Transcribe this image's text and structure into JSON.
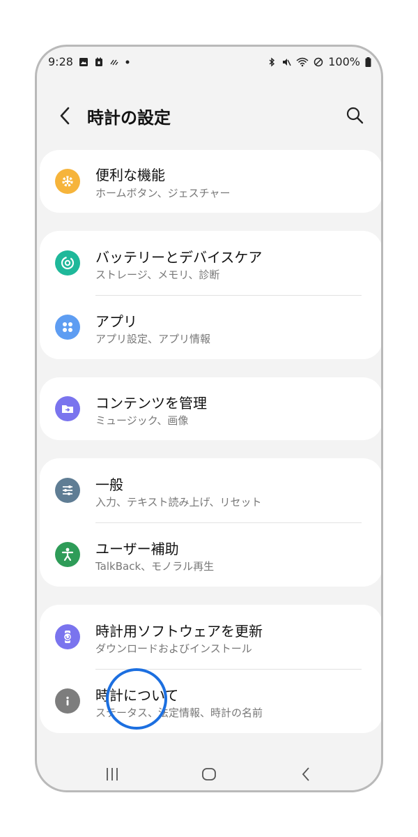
{
  "status_bar": {
    "time": "9:28",
    "battery": "100%",
    "left_icons": [
      "gallery-icon",
      "calendar-icon",
      "wearable-icon",
      "dot-icon"
    ],
    "right_icons": [
      "bluetooth-icon",
      "mute-icon",
      "wifi-icon",
      "dnd-icon",
      "battery-icon"
    ]
  },
  "header": {
    "title": "時計の設定"
  },
  "sections": [
    {
      "items": [
        {
          "title": "便利な機能",
          "subtitle": "ホームボタン、ジェスチャー",
          "icon": "gear-icon",
          "color": "#f6b43b"
        }
      ]
    },
    {
      "items": [
        {
          "title": "バッテリーとデバイスケア",
          "subtitle": "ストレージ、メモリ、診断",
          "icon": "device-care-icon",
          "color": "#1fb89a"
        },
        {
          "title": "アプリ",
          "subtitle": "アプリ設定、アプリ情報",
          "icon": "apps-icon",
          "color": "#5e9df2"
        }
      ]
    },
    {
      "items": [
        {
          "title": "コンテンツを管理",
          "subtitle": "ミュージック、画像",
          "icon": "folder-icon",
          "color": "#7a74ee"
        }
      ]
    },
    {
      "items": [
        {
          "title": "一般",
          "subtitle": "入力、テキスト読み上げ、リセット",
          "icon": "sliders-icon",
          "color": "#5f7d94"
        },
        {
          "title": "ユーザー補助",
          "subtitle": "TalkBack、モノラル再生",
          "icon": "accessibility-icon",
          "color": "#2e9c58"
        }
      ]
    },
    {
      "items": [
        {
          "title": "時計用ソフトウェアを更新",
          "subtitle": "ダウンロードおよびインストール",
          "icon": "watch-update-icon",
          "color": "#7a74ee"
        },
        {
          "title": "時計について",
          "subtitle": "ステータス、法定情報、時計の名前",
          "icon": "info-icon",
          "color": "#7d7d7d"
        }
      ]
    }
  ],
  "navigation": {
    "icons": [
      "recents-icon",
      "home-icon",
      "back-icon"
    ]
  }
}
